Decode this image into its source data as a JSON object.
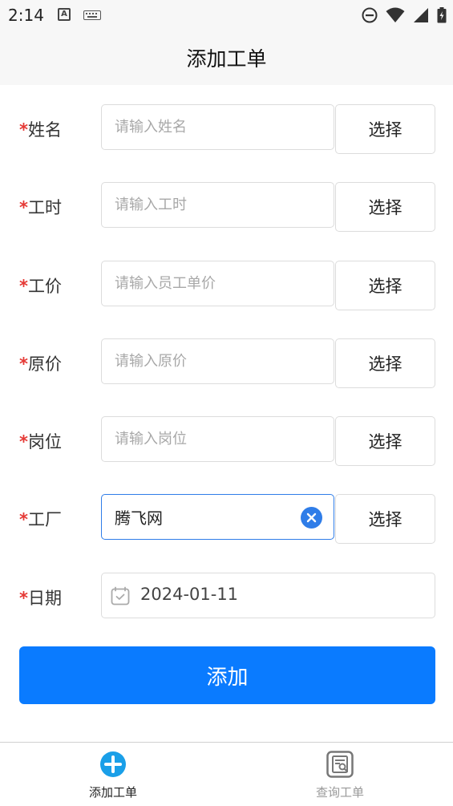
{
  "status_bar": {
    "time": "2:14"
  },
  "header": {
    "title": "添加工单"
  },
  "form": {
    "required_mark": "*",
    "select_label": "选择",
    "rows": [
      {
        "label": "姓名",
        "placeholder": "请输入姓名",
        "value": ""
      },
      {
        "label": "工时",
        "placeholder": "请输入工时",
        "value": ""
      },
      {
        "label": "工价",
        "placeholder": "请输入员工单价",
        "value": ""
      },
      {
        "label": "原价",
        "placeholder": "请输入原价",
        "value": ""
      },
      {
        "label": "岗位",
        "placeholder": "请输入岗位",
        "value": ""
      },
      {
        "label": "工厂",
        "placeholder": "",
        "value": "腾飞网"
      }
    ],
    "date": {
      "label": "日期",
      "value": "2024-01-11"
    },
    "submit_label": "添加"
  },
  "tabbar": {
    "tabs": [
      {
        "label": "添加工单",
        "active": true
      },
      {
        "label": "查询工单",
        "active": false
      }
    ]
  },
  "colors": {
    "accent": "#0a7bff",
    "required": "#e53935",
    "focus": "#2f7de8"
  }
}
